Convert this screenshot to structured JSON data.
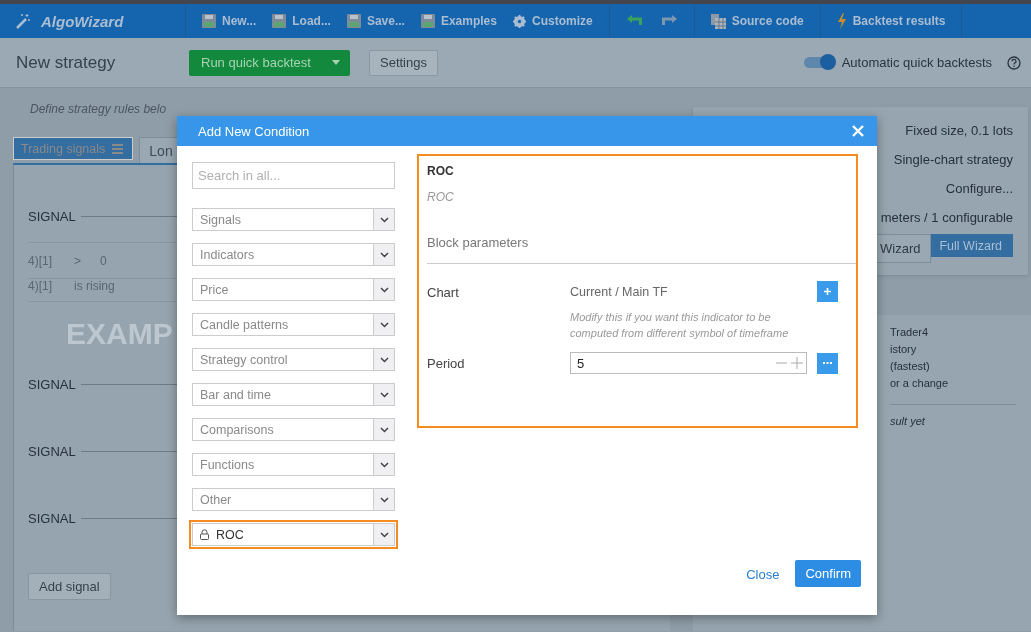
{
  "app_header": {
    "logo": "AlgoWizard",
    "toolbar_groups": [
      [
        {
          "kind": "disk",
          "label": "New...",
          "disabled": false
        },
        {
          "kind": "disk",
          "label": "Load...",
          "disabled": false
        },
        {
          "kind": "disk",
          "label": "Save...",
          "disabled": false
        },
        {
          "kind": "disk",
          "label": "Examples",
          "disabled": false
        },
        {
          "kind": "gear",
          "label": "Customize",
          "disabled": false
        }
      ],
      [
        {
          "kind": "undo",
          "disabled": false
        },
        {
          "kind": "redo",
          "disabled": true
        }
      ],
      [
        {
          "kind": "table",
          "label": "Source code",
          "disabled": false
        }
      ],
      [
        {
          "kind": "bolt",
          "label": "Backtest results",
          "disabled": false
        }
      ]
    ]
  },
  "strategy_bar": {
    "title": "New strategy",
    "run_button": "Run quick backtest",
    "settings_button": "Settings",
    "auto_toggle": {
      "label": "Automatic quick backtests",
      "on": true
    }
  },
  "rules": {
    "intro": "Define strategy rules belo",
    "tabs": [
      {
        "label": "Trading signals",
        "selected": true
      },
      {
        "label": "Lon",
        "selected": false
      }
    ],
    "rows": [
      {
        "kind": "signal",
        "label": "SIGNAL"
      },
      {
        "kind": "condition",
        "cells": [
          "4)[1]",
          ">",
          "0"
        ]
      },
      {
        "kind": "condition",
        "cells": [
          "4)[1]",
          "is rising"
        ]
      },
      {
        "kind": "signal",
        "label": "SIGNAL"
      },
      {
        "kind": "signal",
        "label": "SIGNAL"
      },
      {
        "kind": "signal",
        "label": "SIGNAL"
      }
    ],
    "stamp": "EXAMP",
    "add_button": "Add signal"
  },
  "side_panel": {
    "settings_lines": [
      "Fixed size, 0.1 lots",
      "Single-chart strategy",
      "Configure...",
      "meters / 1 configurable"
    ],
    "wizard_buttons": [
      {
        "label": "Wizard",
        "selected": false
      },
      {
        "label": "Full Wizard",
        "selected": true
      }
    ],
    "info_lines": [
      "Trader4",
      "istory",
      "(fastest)",
      "or a change"
    ],
    "result_text": "sult yet"
  },
  "dialog": {
    "title": "Add New Condition",
    "search": {
      "placeholder": "Search in all..."
    },
    "categories": [
      {
        "label": "Signals",
        "selected": false,
        "locked": false
      },
      {
        "label": "Indicators",
        "selected": false,
        "locked": false
      },
      {
        "label": "Price",
        "selected": false,
        "locked": false
      },
      {
        "label": "Candle patterns",
        "selected": false,
        "locked": false
      },
      {
        "label": "Strategy control",
        "selected": false,
        "locked": false
      },
      {
        "label": "Bar and time",
        "selected": false,
        "locked": false
      },
      {
        "label": "Comparisons",
        "selected": false,
        "locked": false
      },
      {
        "label": "Functions",
        "selected": false,
        "locked": false
      },
      {
        "label": "Other",
        "selected": false,
        "locked": false
      },
      {
        "label": "ROC",
        "selected": true,
        "locked": true
      }
    ],
    "block": {
      "name": "ROC",
      "subtitle": "ROC",
      "section": "Block parameters",
      "params": [
        {
          "kind": "chart",
          "label": "Chart",
          "value": "Current / Main TF",
          "hint": "Modify this if you want this indicator to be computed from different symbol of timeframe"
        },
        {
          "kind": "number",
          "label": "Period",
          "value": "5"
        }
      ]
    },
    "close_link": "Close",
    "confirm_button": "Confirm"
  }
}
